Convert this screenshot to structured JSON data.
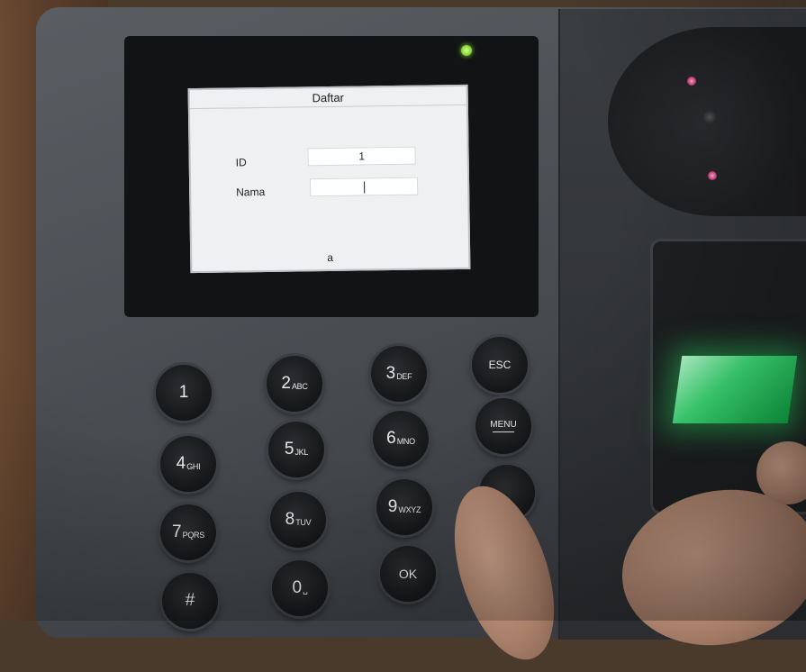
{
  "screen": {
    "title": "Daftar",
    "fields": [
      {
        "label": "ID",
        "value": "1"
      },
      {
        "label": "Nama",
        "value": ""
      }
    ],
    "input_mode": "a"
  },
  "keypad": {
    "keys": [
      {
        "digit": "1",
        "letters": ""
      },
      {
        "digit": "2",
        "letters": "ABC"
      },
      {
        "digit": "3",
        "letters": "DEF"
      },
      {
        "label": "ESC"
      },
      {
        "digit": "4",
        "letters": "GHI"
      },
      {
        "digit": "5",
        "letters": "JKL"
      },
      {
        "digit": "6",
        "letters": "MNO"
      },
      {
        "label": "MENU"
      },
      {
        "digit": "7",
        "letters": "PQRS"
      },
      {
        "digit": "8",
        "letters": "TUV"
      },
      {
        "digit": "9",
        "letters": "WXYZ"
      },
      {
        "digit": "#",
        "letters": ""
      },
      {
        "digit": "0",
        "letters": "␣"
      },
      {
        "label": "OK"
      }
    ]
  },
  "colors": {
    "lcd_background": "#eef0f2",
    "sensor_glow": "#3fe07a",
    "power_led": "#7ad12a",
    "device_body": "#4a4e53"
  }
}
